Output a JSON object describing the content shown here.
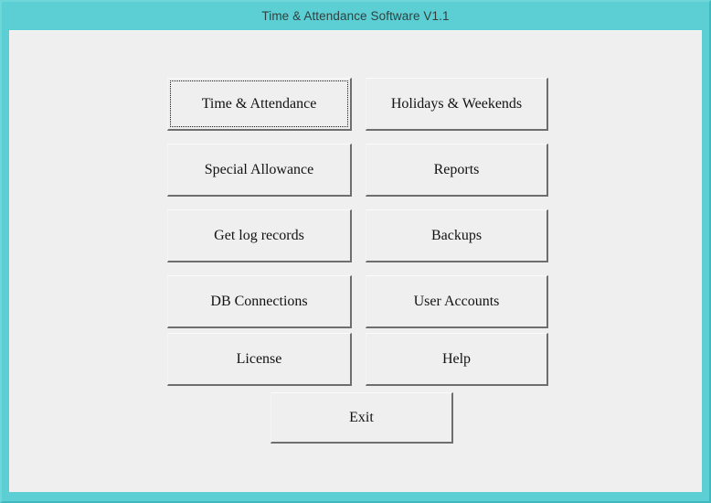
{
  "window": {
    "title": "Time & Attendance Software V1.1",
    "titlebar_color": "#5ccfd4",
    "client_color": "#efefef",
    "button_face_color": "#efefef",
    "button_shadow_color": "#6e6e6e",
    "text_color": "#121212"
  },
  "menu": {
    "buttons": [
      {
        "label": "Time & Attendance",
        "name": "time-and-attendance",
        "focused": true
      },
      {
        "label": "Holidays & Weekends",
        "name": "holidays-and-weekends",
        "focused": false
      },
      {
        "label": "Special Allowance",
        "name": "special-allowance",
        "focused": false
      },
      {
        "label": "Reports",
        "name": "reports",
        "focused": false
      },
      {
        "label": "Get log records",
        "name": "get-log-records",
        "focused": false
      },
      {
        "label": "Backups",
        "name": "backups",
        "focused": false
      },
      {
        "label": "DB Connections",
        "name": "db-connections",
        "focused": false
      },
      {
        "label": "User Accounts",
        "name": "user-accounts",
        "focused": false
      },
      {
        "label": "License",
        "name": "license",
        "focused": false
      },
      {
        "label": "Help",
        "name": "help",
        "focused": false
      }
    ],
    "exit": {
      "label": "Exit",
      "name": "exit"
    }
  }
}
